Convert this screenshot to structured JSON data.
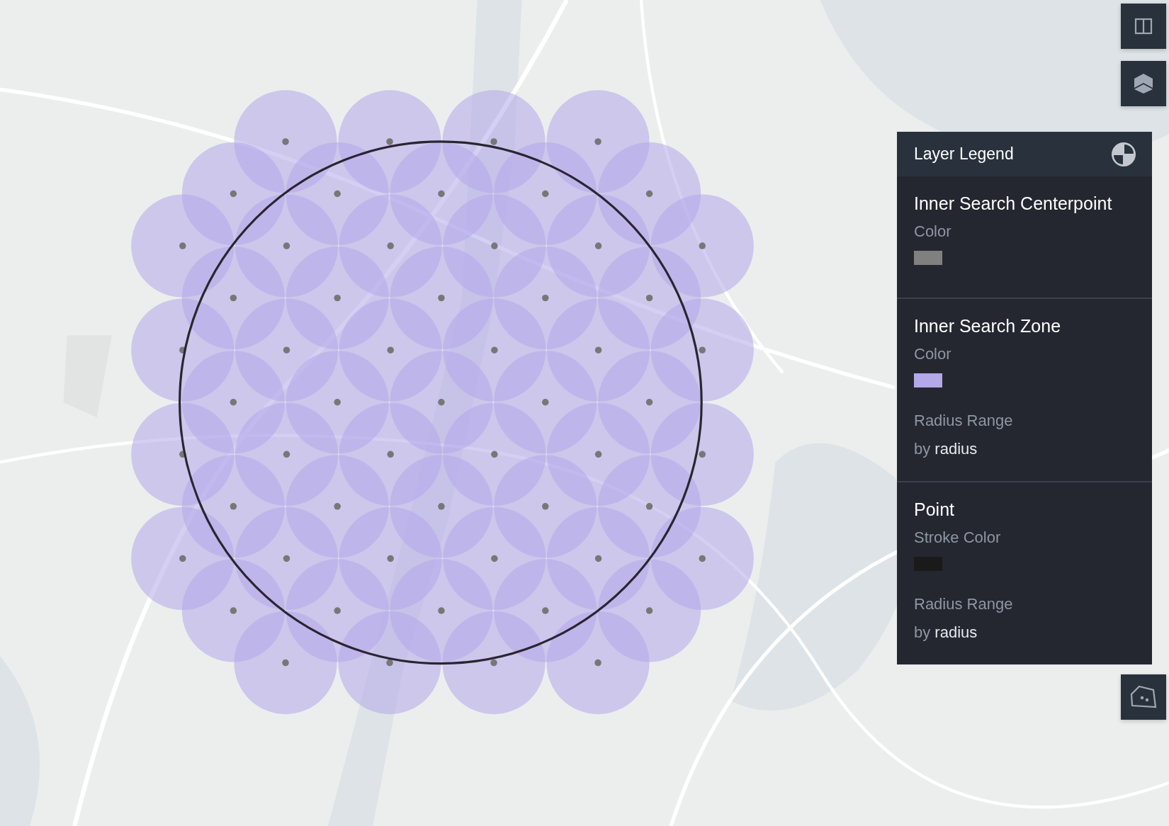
{
  "legend": {
    "title": "Layer Legend",
    "layers": [
      {
        "name": "Inner Search Centerpoint",
        "entries": [
          {
            "kind": "color",
            "label": "Color",
            "color": "#808080"
          }
        ]
      },
      {
        "name": "Inner Search Zone",
        "entries": [
          {
            "kind": "color",
            "label": "Color",
            "color": "#b3a8e8"
          },
          {
            "kind": "radius",
            "label": "Radius Range",
            "text": "by **radius**"
          }
        ]
      },
      {
        "name": "Point",
        "entries": [
          {
            "kind": "color",
            "label": "Stroke Color",
            "color": "#1a1a1a"
          },
          {
            "kind": "radius",
            "label": "Radius Range",
            "text": "by **radius**"
          }
        ]
      }
    ]
  }
}
